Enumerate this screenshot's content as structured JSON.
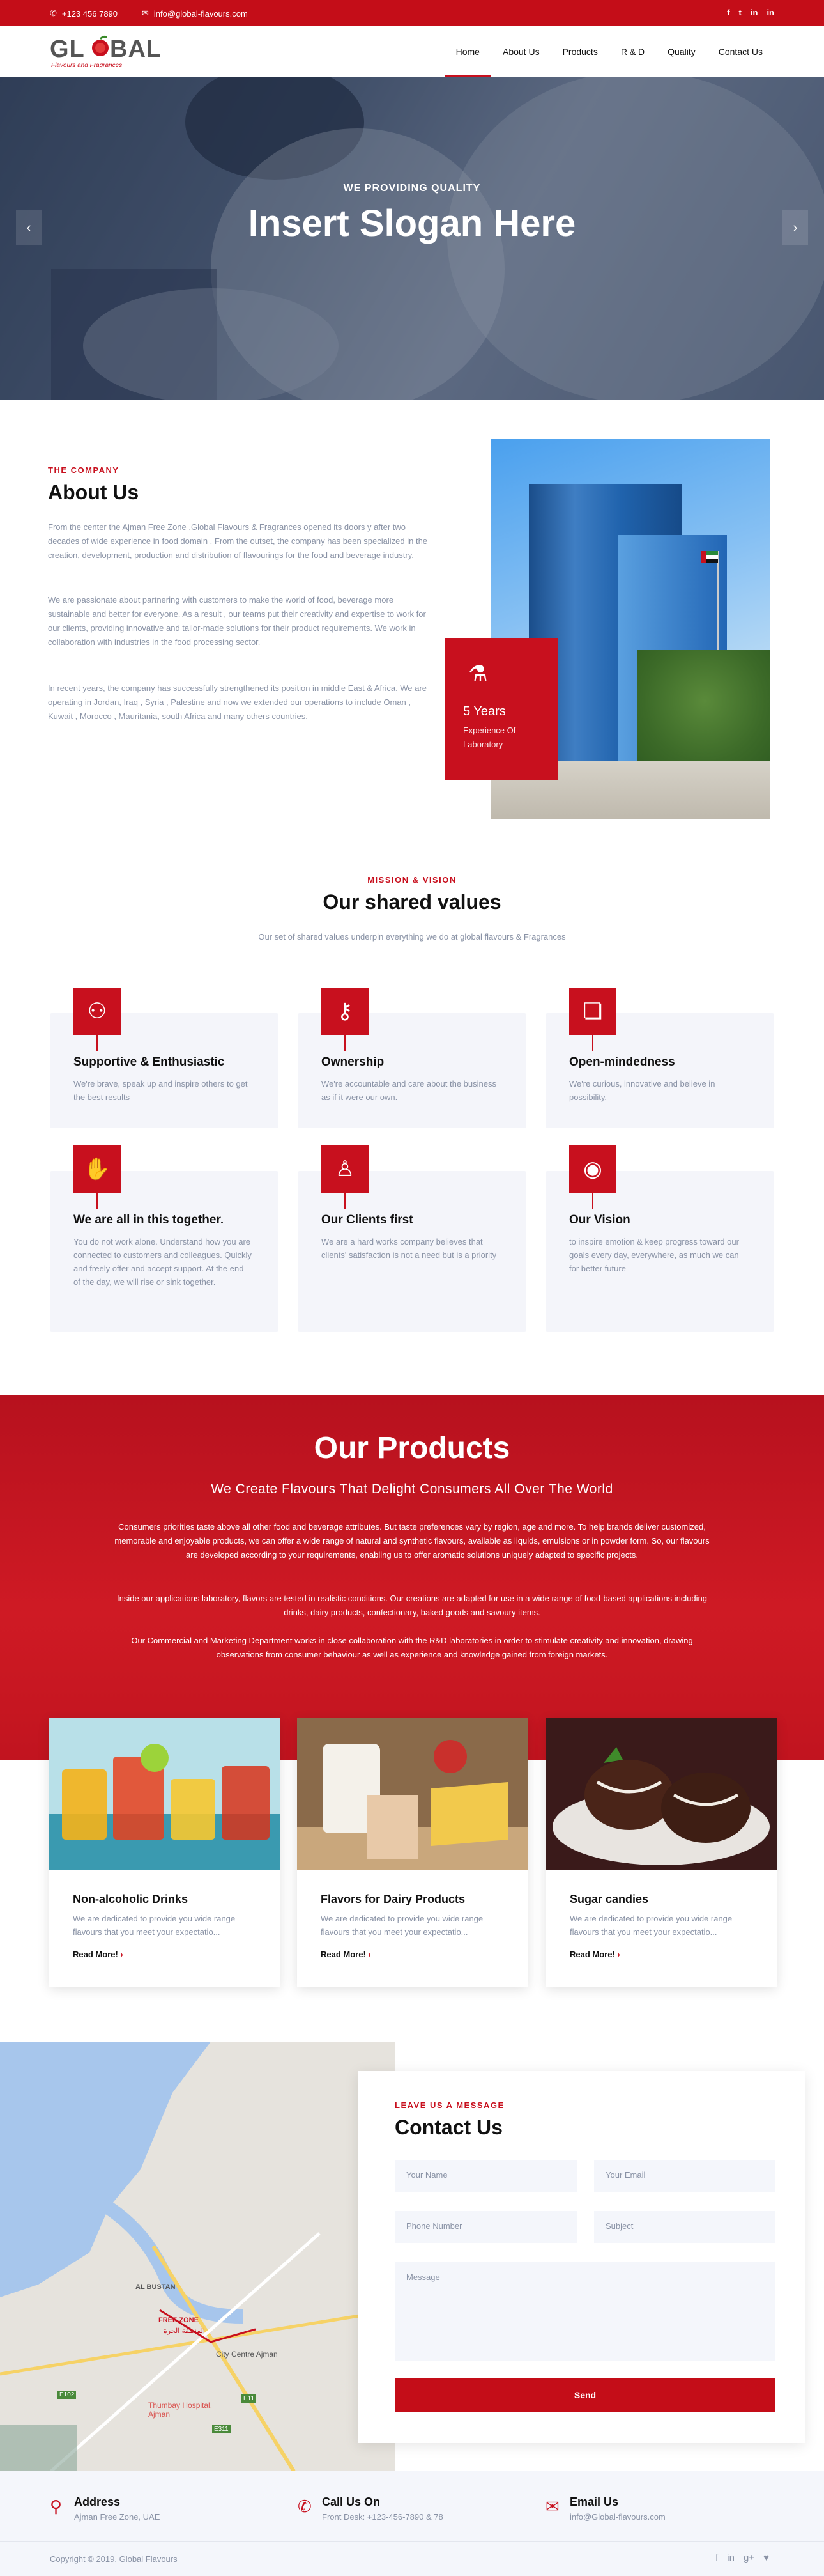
{
  "topbar": {
    "phone": "+123 456 7890",
    "email": "info@global-flavours.com",
    "social": [
      "f",
      "t",
      "in",
      "in"
    ]
  },
  "brand": {
    "name": "GL BAL",
    "tagline": "Flavours and Fragrances"
  },
  "nav": {
    "items": [
      "Home",
      "About Us",
      "Products",
      "R & D",
      "Quality",
      "Contact Us"
    ],
    "active": "Home"
  },
  "hero": {
    "subtitle": "WE PROVIDING QUALITY",
    "title": "Insert Slogan Here",
    "prev": "‹",
    "next": "›"
  },
  "about": {
    "tag": "THE COMPANY",
    "title": "About Us",
    "p1": "From the center the Ajman Free Zone ,Global Flavours & Fragrances opened its doors y after two decades of wide experience in food domain . From the outset, the company has been specialized in the creation, development, production and distribution of flavourings for the food and beverage industry.",
    "p2": "We are passionate about partnering with customers to make the world of food, beverage more sustainable and better for everyone. As a result , our teams put their creativity and expertise to work for our clients, providing innovative and tailor-made solutions for their product requirements. We work in collaboration with industries in the food processing sector.",
    "p3": "In recent years, the company has successfully strengthened its position in middle East & Africa. We are operating in Jordan, Iraq , Syria , Palestine and now we extended our operations to include Oman , Kuwait , Morocco , Mauritania, south Africa and many others countries.",
    "badge_years": "5 Years",
    "badge_label": "Experience Of Laboratory"
  },
  "values": {
    "tag": "MISSION & VISION",
    "title": "Our shared values",
    "subtitle": "Our set of shared values underpin everything we do at global flavours & Fragrances",
    "items": [
      {
        "title": "Supportive & Enthusiastic",
        "text": "We're brave, speak up and inspire others to get the best results",
        "icon": "people-icon"
      },
      {
        "title": "Ownership",
        "text": "We're accountable and care about the business as if it were our own.",
        "icon": "key-icon"
      },
      {
        "title": "Open-mindedness",
        "text": "We're curious, innovative and believe in possibility.",
        "icon": "chat-icon"
      },
      {
        "title": "We are all in this together.",
        "text": "You do not work alone. Understand how you are connected to customers and colleagues. Quickly and freely offer and accept support. At the end of the day, we will rise or sink together.",
        "icon": "handshake-icon"
      },
      {
        "title": "Our Clients first",
        "text": "We are a hard works company believes that clients' satisfaction is not a need but is a priority",
        "icon": "user-icon"
      },
      {
        "title": "Our Vision",
        "text": "to inspire emotion & keep progress toward our goals every day, everywhere, as much we can for better future",
        "icon": "eye-icon"
      }
    ]
  },
  "products": {
    "title": "Our Products",
    "subtitle": "We Create Flavours That Delight Consumers All Over The World",
    "p1": "Consumers priorities taste above all other food and beverage attributes. But taste preferences vary by region, age and more. To help brands deliver customized, memorable and enjoyable products, we can offer a wide range of natural and synthetic flavours, available as liquids, emulsions or in powder form. So, our flavours are developed according to your requirements, enabling us to offer aromatic solutions uniquely adapted to specific projects.",
    "p2": "Inside our applications laboratory, flavors are tested in realistic conditions. Our creations are adapted for use in a wide range of food-based applications including drinks, dairy products, confectionary, baked goods and savoury items.",
    "p3": "Our Commercial and Marketing Department works in close collaboration with the R&D laboratories in order to stimulate creativity and innovation, drawing observations from consumer behaviour as well as experience and knowledge gained from foreign markets.",
    "cards": [
      {
        "title": "Non-alcoholic Drinks",
        "text": "We are dedicated to provide you wide range flavours that you meet your expectatio...",
        "link": "Read More!"
      },
      {
        "title": "Flavors for Dairy Products",
        "text": "We are dedicated to provide you wide range flavours that you meet your expectatio...",
        "link": "Read More!"
      },
      {
        "title": "Sugar candies",
        "text": "We are dedicated to provide you wide range flavours that you meet your expectatio...",
        "link": "Read More!"
      }
    ]
  },
  "map": {
    "labels": [
      "AL BUSTAN",
      "FREE ZONE",
      "المنطقة الحرة",
      "City Centre Ajman",
      "Thumbay Hospital, Ajman",
      "E11",
      "E102",
      "E311"
    ]
  },
  "contact": {
    "tag": "LEAVE US A MESSAGE",
    "title": "Contact Us",
    "name_ph": "Your Name",
    "email_ph": "Your Email",
    "phone_ph": "Phone Number",
    "subject_ph": "Subject",
    "message_ph": "Message",
    "send": "Send"
  },
  "info": [
    {
      "title": "Address",
      "text": "Ajman Free Zone, UAE"
    },
    {
      "title": "Call Us On",
      "text": "Front Desk: +123-456-7890 & 78"
    },
    {
      "title": "Email Us",
      "text": "info@Global-flavours.com"
    }
  ],
  "footer": {
    "copyright": "Copyright © 2019, Global Flavours",
    "social": [
      "f",
      "in",
      "g+",
      "♥"
    ]
  },
  "colors": {
    "accent": "#c8101e",
    "muted": "#8a93a6",
    "card_bg": "#f4f5fa"
  }
}
